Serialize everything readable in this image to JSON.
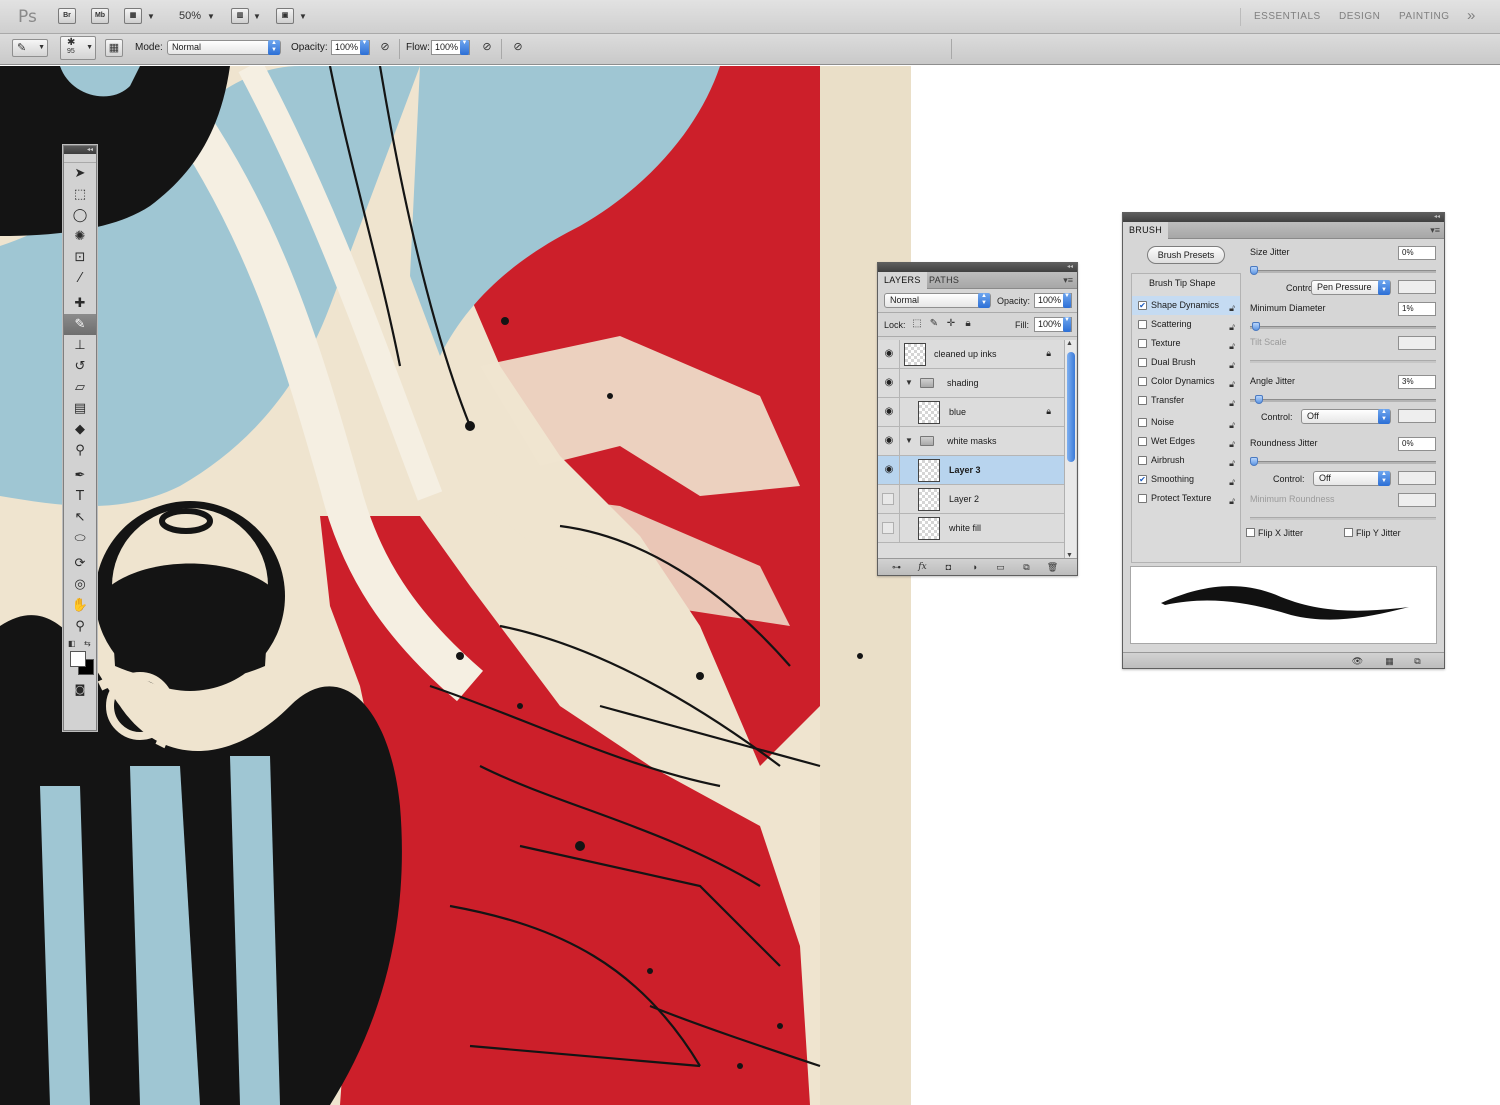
{
  "app": {
    "logo": "Ps",
    "bridge": "Br",
    "minibridge": "Mb",
    "zoom": "50%",
    "workspaces": [
      "ESSENTIALS",
      "DESIGN",
      "PAINTING"
    ],
    "more": "»"
  },
  "options": {
    "brush_size": "95",
    "mode_label": "Mode:",
    "mode_value": "Normal",
    "opacity_label": "Opacity:",
    "opacity_value": "100%",
    "flow_label": "Flow:",
    "flow_value": "100%"
  },
  "tools": {
    "collapse": "◂◂",
    "items": [
      {
        "name": "move-tool-icon",
        "glyph": "➤"
      },
      {
        "name": "marquee-tool-icon",
        "glyph": "⬚"
      },
      {
        "name": "lasso-tool-icon",
        "glyph": "◯"
      },
      {
        "name": "quick-select-tool-icon",
        "glyph": "✺"
      },
      {
        "name": "crop-tool-icon",
        "glyph": "⊡"
      },
      {
        "name": "eyedropper-tool-icon",
        "glyph": "⁄"
      },
      {
        "name": "healing-brush-tool-icon",
        "glyph": "✚"
      },
      {
        "name": "brush-tool-icon",
        "glyph": "✎"
      },
      {
        "name": "clone-stamp-tool-icon",
        "glyph": "⊥"
      },
      {
        "name": "history-brush-tool-icon",
        "glyph": "↺"
      },
      {
        "name": "eraser-tool-icon",
        "glyph": "▱"
      },
      {
        "name": "gradient-tool-icon",
        "glyph": "▤"
      },
      {
        "name": "blur-tool-icon",
        "glyph": "◆"
      },
      {
        "name": "dodge-tool-icon",
        "glyph": "⚲"
      },
      {
        "name": "pen-tool-icon",
        "glyph": "✒"
      },
      {
        "name": "type-tool-icon",
        "glyph": "T"
      },
      {
        "name": "path-select-tool-icon",
        "glyph": "↖"
      },
      {
        "name": "shape-tool-icon",
        "glyph": "⬭"
      },
      {
        "name": "3d-rotate-tool-icon",
        "glyph": "⟳"
      },
      {
        "name": "3d-orbit-tool-icon",
        "glyph": "◎"
      },
      {
        "name": "hand-tool-icon",
        "glyph": "✋"
      },
      {
        "name": "zoom-tool-icon",
        "glyph": "⚲"
      }
    ],
    "active_index": 7
  },
  "layers": {
    "tabs": [
      "LAYERS",
      "PATHS"
    ],
    "blend_mode": "Normal",
    "opacity_label": "Opacity:",
    "opacity_value": "100%",
    "lock_label": "Lock:",
    "fill_label": "Fill:",
    "fill_value": "100%",
    "items": [
      {
        "name": "cleaned up inks",
        "visible": true,
        "locked": true,
        "type": "layer",
        "indent": 0,
        "selected": false
      },
      {
        "name": "shading",
        "visible": true,
        "locked": false,
        "type": "group",
        "indent": 0,
        "selected": false
      },
      {
        "name": "blue",
        "visible": true,
        "locked": true,
        "type": "layer",
        "indent": 1,
        "selected": false
      },
      {
        "name": "white masks",
        "visible": true,
        "locked": false,
        "type": "group",
        "indent": 0,
        "selected": false
      },
      {
        "name": "Layer 3",
        "visible": true,
        "locked": false,
        "type": "layer",
        "indent": 1,
        "selected": true
      },
      {
        "name": "Layer 2",
        "visible": false,
        "locked": false,
        "type": "layer",
        "indent": 1,
        "selected": false
      },
      {
        "name": "white fill",
        "visible": false,
        "locked": false,
        "type": "layer",
        "indent": 1,
        "selected": false
      }
    ]
  },
  "brush": {
    "tab": "BRUSH",
    "presets_button": "Brush Presets",
    "sections": [
      {
        "label": "Brush Tip Shape",
        "checkbox": false,
        "checked": false,
        "active": false
      },
      {
        "label": "Shape Dynamics",
        "checkbox": true,
        "checked": true,
        "active": true
      },
      {
        "label": "Scattering",
        "checkbox": true,
        "checked": false,
        "active": false
      },
      {
        "label": "Texture",
        "checkbox": true,
        "checked": false,
        "active": false
      },
      {
        "label": "Dual Brush",
        "checkbox": true,
        "checked": false,
        "active": false
      },
      {
        "label": "Color Dynamics",
        "checkbox": true,
        "checked": false,
        "active": false
      },
      {
        "label": "Transfer",
        "checkbox": true,
        "checked": false,
        "active": false
      },
      {
        "label": "Noise",
        "checkbox": true,
        "checked": false,
        "active": false
      },
      {
        "label": "Wet Edges",
        "checkbox": true,
        "checked": false,
        "active": false
      },
      {
        "label": "Airbrush",
        "checkbox": true,
        "checked": false,
        "active": false
      },
      {
        "label": "Smoothing",
        "checkbox": true,
        "checked": true,
        "active": false
      },
      {
        "label": "Protect Texture",
        "checkbox": true,
        "checked": false,
        "active": false
      }
    ],
    "size_jitter_label": "Size Jitter",
    "size_jitter_value": "0%",
    "size_jitter_fraction": 0.0,
    "control_label": "Control:",
    "size_control": "Pen Pressure",
    "min_diameter_label": "Minimum Diameter",
    "min_diameter_value": "1%",
    "min_diameter_fraction": 0.01,
    "tilt_scale_label": "Tilt Scale",
    "angle_jitter_label": "Angle Jitter",
    "angle_jitter_value": "3%",
    "angle_jitter_fraction": 0.03,
    "angle_control": "Off",
    "roundness_jitter_label": "Roundness Jitter",
    "roundness_jitter_value": "0%",
    "roundness_jitter_fraction": 0.0,
    "roundness_control": "Off",
    "min_roundness_label": "Minimum Roundness",
    "flip_x_label": "Flip X Jitter",
    "flip_y_label": "Flip Y Jitter"
  },
  "colors": {
    "canvas_paper": "#efe4cf",
    "red": "#cc1f2a",
    "blue": "#9fc6d3",
    "ink": "#141414",
    "selection": "#b8d4ee"
  }
}
